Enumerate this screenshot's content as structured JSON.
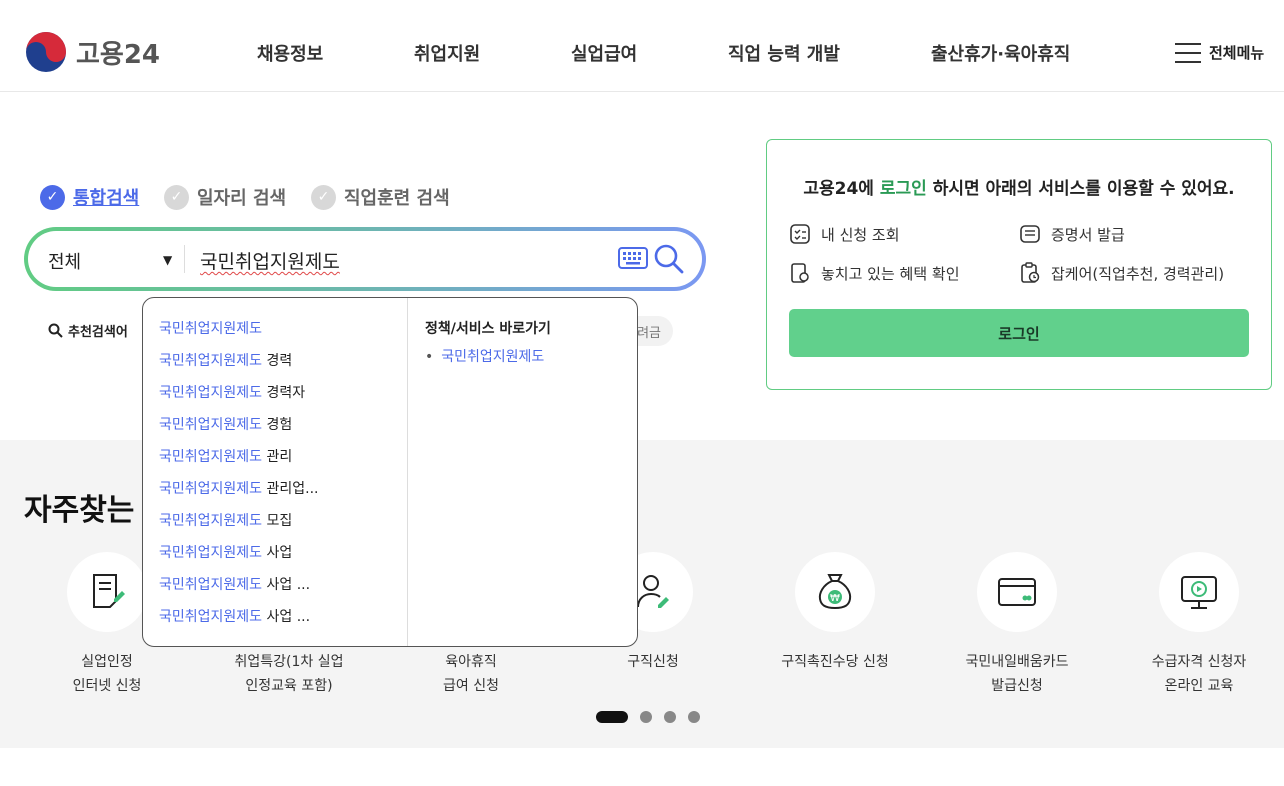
{
  "header": {
    "logo_text": "고용24",
    "nav": [
      "채용정보",
      "취업지원",
      "실업급여",
      "직업 능력 개발",
      "출산휴가·육아휴직"
    ],
    "all_menu_label": "전체메뉴"
  },
  "search": {
    "tabs": [
      "통합검색",
      "일자리 검색",
      "직업훈련 검색"
    ],
    "active_tab": "통합검색",
    "scope_value": "전체",
    "query": "국민취업지원제도",
    "recommended_label": "추천검색어",
    "hidden_chip_text": "려금",
    "suggestions": [
      {
        "kw": "국민취업지원제도",
        "rest": ""
      },
      {
        "kw": "국민취업지원제도",
        "rest": " 경력"
      },
      {
        "kw": "국민취업지원제도",
        "rest": " 경력자"
      },
      {
        "kw": "국민취업지원제도",
        "rest": " 경험"
      },
      {
        "kw": "국민취업지원제도",
        "rest": " 관리"
      },
      {
        "kw": "국민취업지원제도",
        "rest": " 관리업..."
      },
      {
        "kw": "국민취업지원제도",
        "rest": " 모집"
      },
      {
        "kw": "국민취업지원제도",
        "rest": " 사업"
      },
      {
        "kw": "국민취업지원제도",
        "rest": " 사업 ..."
      },
      {
        "kw": "국민취업지원제도",
        "rest": " 사업 ..."
      }
    ],
    "shortcut_title": "정책/서비스 바로가기",
    "shortcut_link": "국민취업지원제도"
  },
  "login": {
    "msg_prefix": "고용24에 ",
    "msg_highlight": "로그인",
    "msg_suffix": " 하시면 아래의 서비스를 이용할 수 있어요.",
    "services": [
      "내 신청 조회",
      "증명서 발급",
      "놓치고 있는 혜택 확인",
      "잡케어(직업추천, 경력관리)"
    ],
    "button_label": "로그인"
  },
  "frequent": {
    "title": "자주찾는 서",
    "items": [
      {
        "label": "실업인정\n인터넷 신청",
        "icon": "document-pen-icon"
      },
      {
        "label": "취업특강(1차 실업\n인정교육 포함)",
        "icon": "lecture-icon"
      },
      {
        "label": "육아휴직\n급여 신청",
        "icon": "baby-icon"
      },
      {
        "label": "구직신청",
        "icon": "person-pen-icon"
      },
      {
        "label": "구직촉진수당 신청",
        "icon": "money-bag-icon"
      },
      {
        "label": "국민내일배움카드\n발급신청",
        "icon": "card-icon"
      },
      {
        "label": "수급자격 신청자\n온라인 교육",
        "icon": "monitor-play-icon"
      }
    ],
    "carousel_pages": 4,
    "carousel_active": 1
  },
  "colors": {
    "accent_blue": "#4c6ae8",
    "accent_green": "#61d08c",
    "brand_text_green": "#2a9a55"
  }
}
